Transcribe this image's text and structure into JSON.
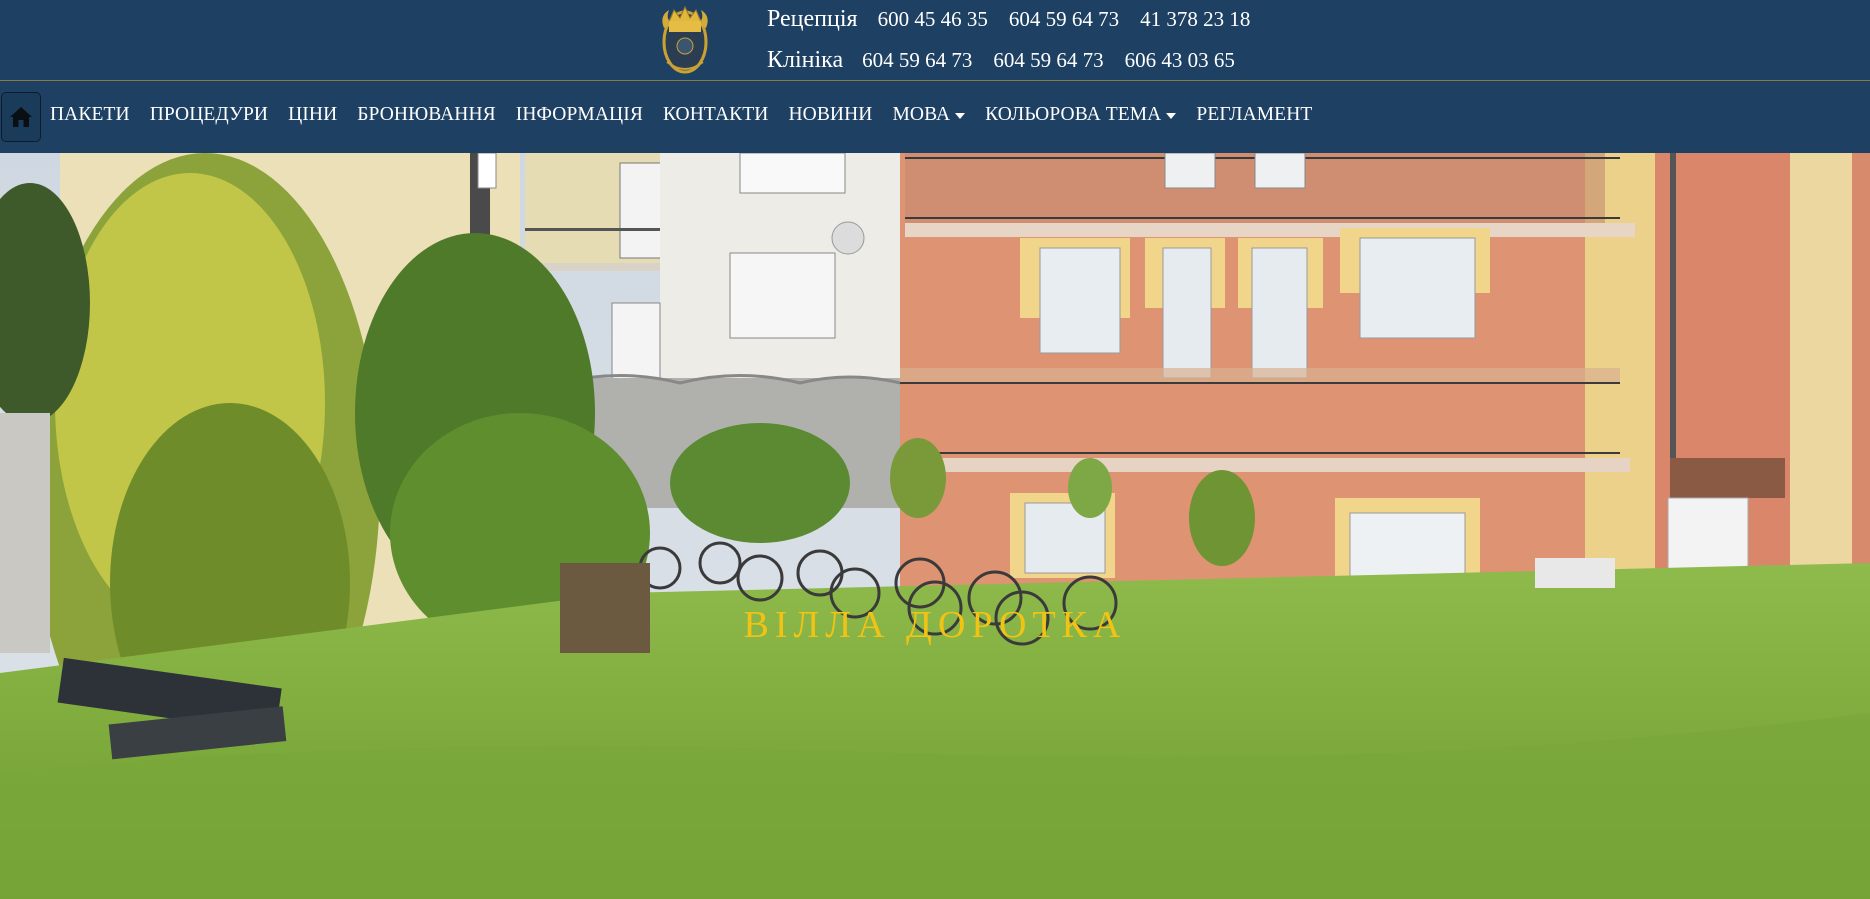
{
  "contacts": {
    "reception": {
      "label": "Рецепція",
      "phones": [
        "600 45 46 35",
        "604 59 64 73",
        "41 378 23 18"
      ]
    },
    "clinic": {
      "label": "Клініка",
      "phones": [
        "604 59 64 73",
        "604 59 64 73",
        "606 43 03 65"
      ]
    }
  },
  "nav": {
    "home_icon": "home-icon",
    "items": [
      {
        "label": "ПАКЕТИ"
      },
      {
        "label": "ПРОЦЕДУРИ"
      },
      {
        "label": "ЦІНИ"
      },
      {
        "label": "БРОНЮВАННЯ"
      },
      {
        "label": "ІНФОРМАЦІЯ"
      },
      {
        "label": "КОНТАКТИ"
      },
      {
        "label": "НОВИНИ"
      },
      {
        "label": "МОВА",
        "dropdown": true
      },
      {
        "label": "КОЛЬОРОВА ТЕМА",
        "dropdown": true
      },
      {
        "label": "РЕГЛАМЕНТ"
      }
    ]
  },
  "hero": {
    "title": "ВІЛЛА ДОРОТКА"
  },
  "colors": {
    "header_bg": "#1e4163",
    "text": "#ffffff",
    "hero_title": "#f2c314"
  }
}
